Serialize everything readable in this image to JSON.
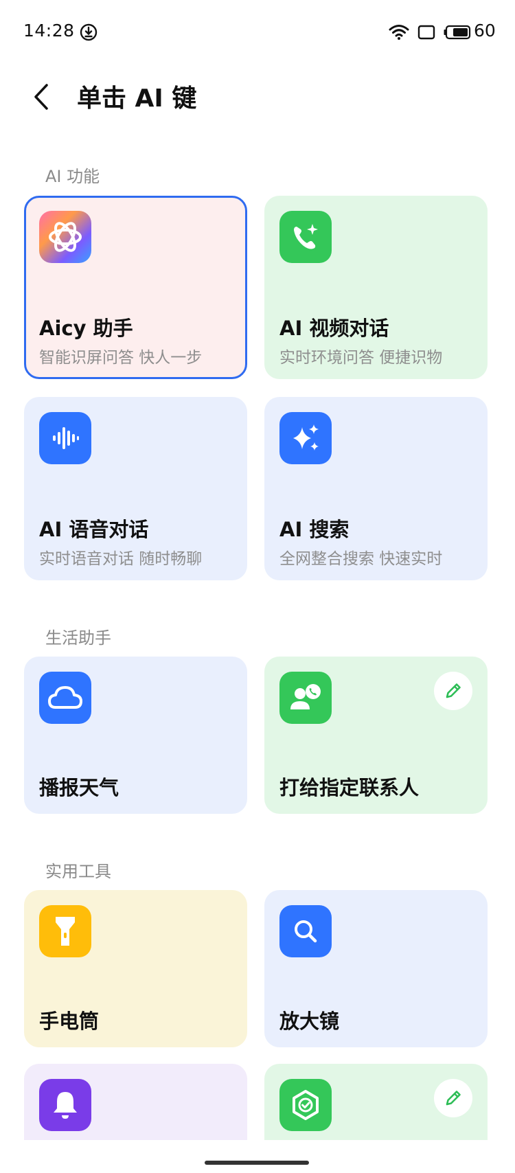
{
  "status_bar": {
    "time": "14:28",
    "battery": "60"
  },
  "header": {
    "title": "单击 AI 键"
  },
  "sections": {
    "ai": {
      "title": "AI 功能"
    },
    "life": {
      "title": "生活助手"
    },
    "tools": {
      "title": "实用工具"
    }
  },
  "cards": {
    "aicy": {
      "title": "Aicy 助手",
      "subtitle": "智能识屏问答 快人一步"
    },
    "video": {
      "title": "AI 视频对话",
      "subtitle": "实时环境问答 便捷识物"
    },
    "voice": {
      "title": "AI 语音对话",
      "subtitle": "实时语音对话 随时畅聊"
    },
    "search": {
      "title": "AI 搜索",
      "subtitle": "全网整合搜索 快速实时"
    },
    "weather": {
      "title": "播报天气"
    },
    "contact": {
      "title": "打给指定联系人"
    },
    "flashlight": {
      "title": "手电筒"
    },
    "magnifier": {
      "title": "放大镜"
    }
  },
  "colors": {
    "accent": "#2f6bf0",
    "green_icon": "#34c759",
    "blue_icon": "#2f74ff",
    "yellow_icon": "#ffbd0a",
    "purple_icon": "#7a3ce8"
  }
}
